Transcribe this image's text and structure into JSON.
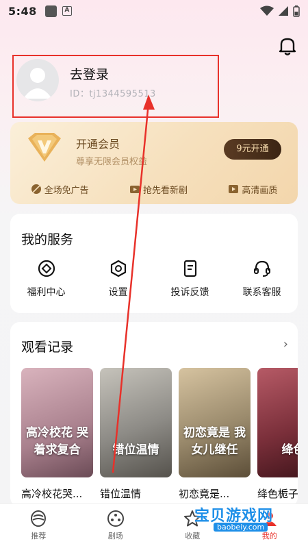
{
  "status_bar": {
    "time": "5:48",
    "a_label": "A"
  },
  "profile": {
    "login_label": "去登录",
    "user_id": "ID：tj1344595513"
  },
  "vip": {
    "title": "开通会员",
    "subtitle": "尊享无限会员权益",
    "button_label": "9元开通",
    "perks": [
      "全场免广告",
      "抢先看新剧",
      "高清画质"
    ]
  },
  "services": {
    "title": "我的服务",
    "items": [
      {
        "label": "福利中心",
        "icon": "diamond-icon"
      },
      {
        "label": "设置",
        "icon": "settings-hexagon-icon"
      },
      {
        "label": "投诉反馈",
        "icon": "document-icon"
      },
      {
        "label": "联系客服",
        "icon": "headset-icon"
      }
    ]
  },
  "history": {
    "title": "观看记录",
    "more_icon": "chevron-right-icon",
    "items": [
      {
        "title": "高冷校花哭...",
        "cover_text": "高冷校花 哭着求复合",
        "color": "#b8909a"
      },
      {
        "title": "错位温情",
        "cover_text": "错位温情",
        "color": "#8d8b86"
      },
      {
        "title": "初恋竟是...",
        "cover_text": "初恋竟是 我女儿继任",
        "color": "#9a8a6c"
      },
      {
        "title": "绛色栀子",
        "cover_text": "绛色",
        "color": "#7a2f3a"
      }
    ]
  },
  "tabs": [
    {
      "label": "推荐",
      "icon": "recommend-icon"
    },
    {
      "label": "剧场",
      "icon": "theater-icon"
    },
    {
      "label": "收藏",
      "icon": "star-icon"
    },
    {
      "label": "我的",
      "icon": "profile-icon"
    }
  ],
  "watermark": {
    "text": "宝贝游戏网",
    "url": "baobeiy.com"
  },
  "colors": {
    "accent": "#e8312a",
    "vip_brown": "#6b4a21",
    "watermark_blue": "#1e8fe8"
  }
}
